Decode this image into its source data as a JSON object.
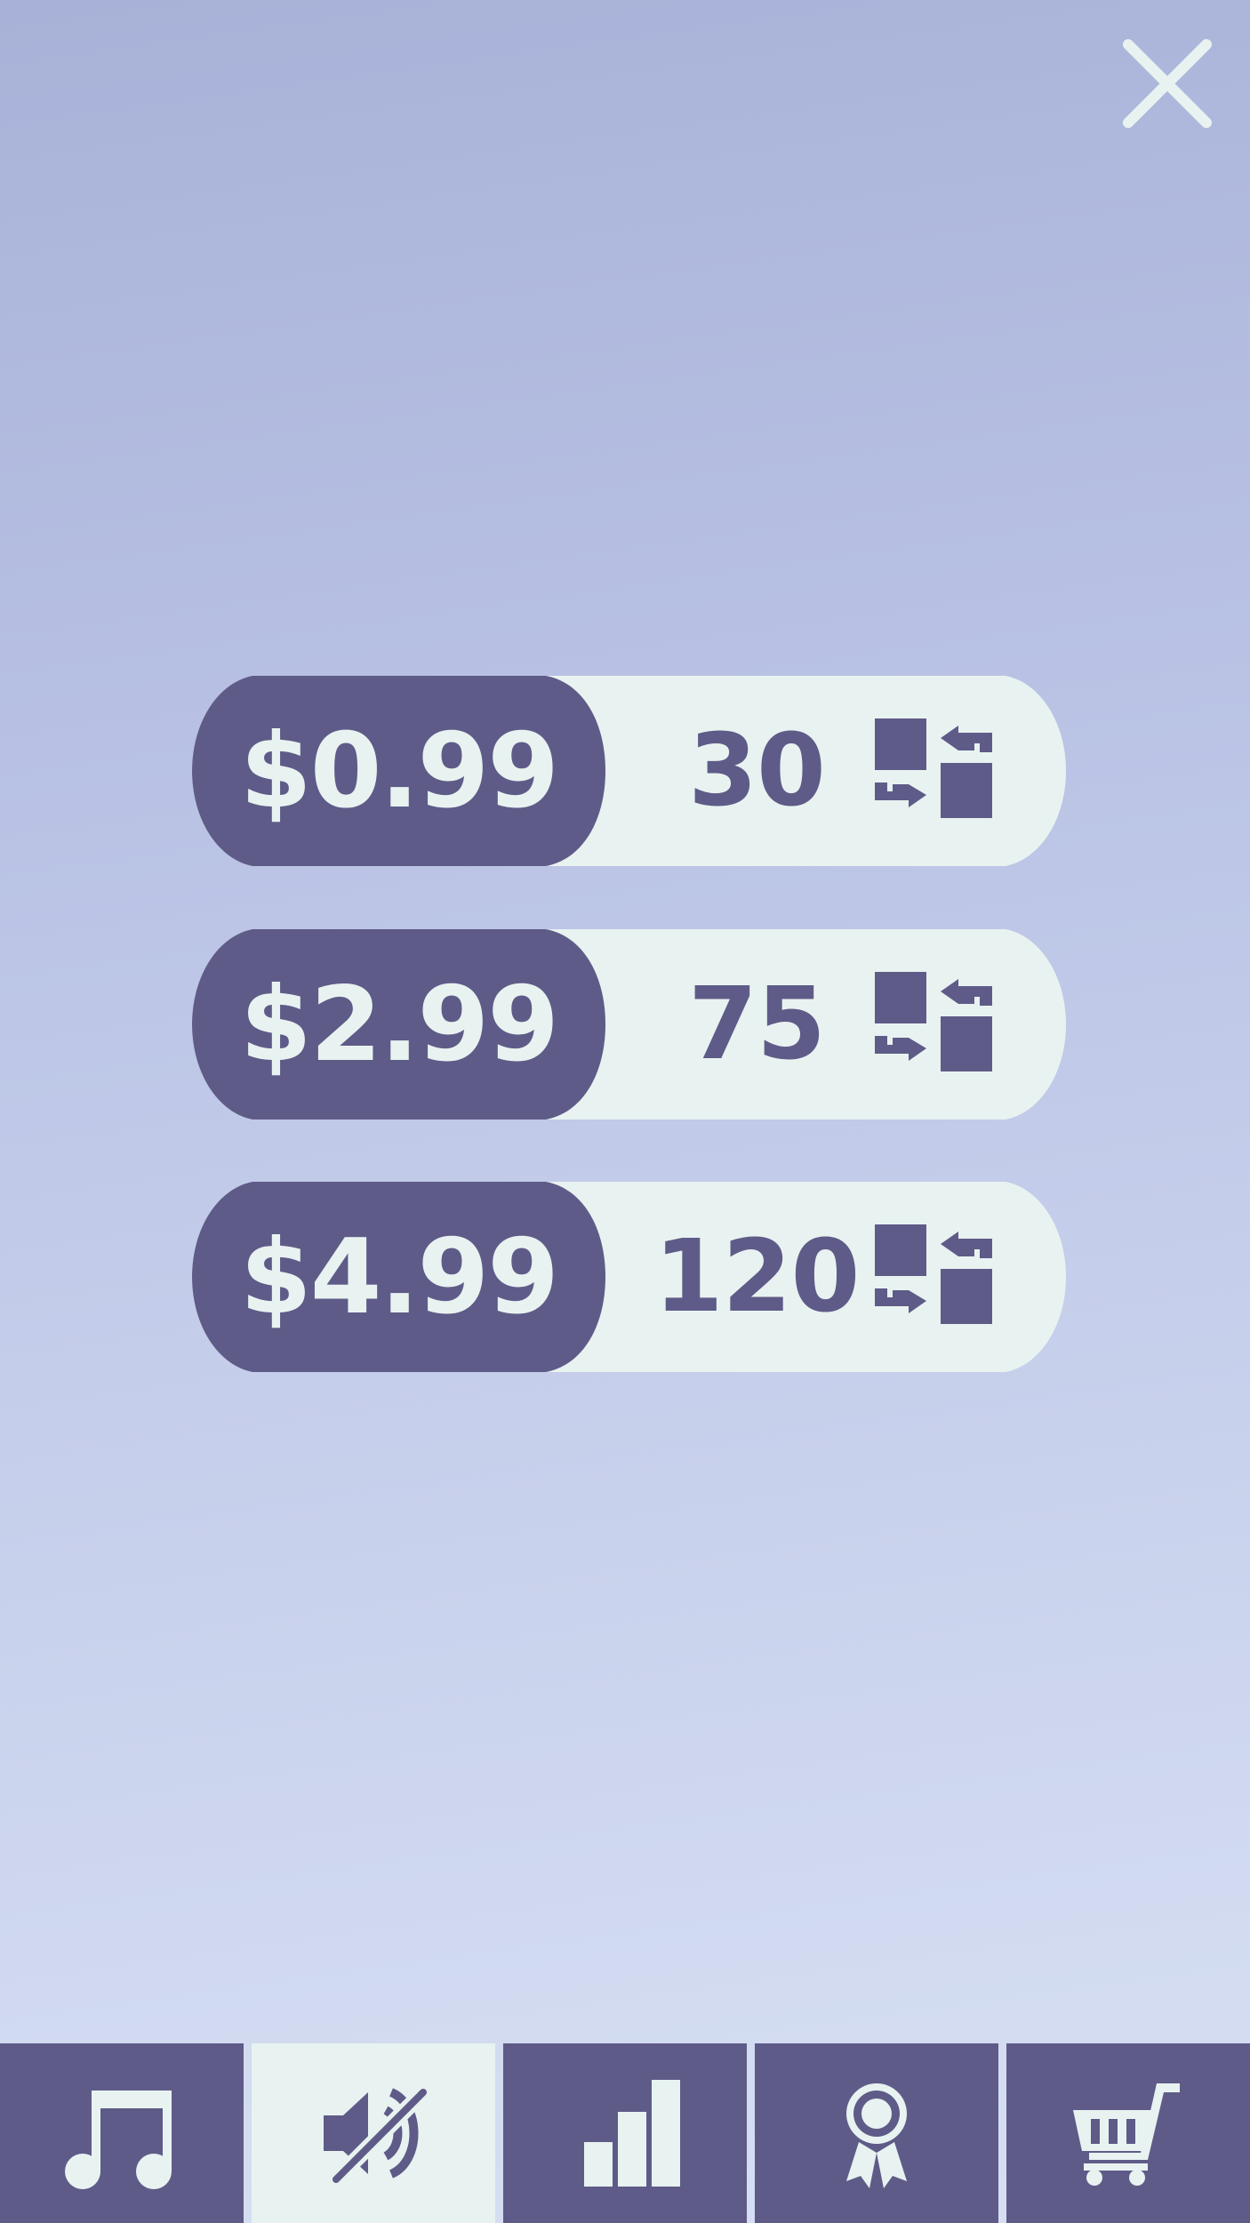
{
  "colors": {
    "accent": "#5f5b88",
    "light": "#e8f3f1",
    "background_top": "#a8b2d8",
    "background_bottom": "#d6def2"
  },
  "header": {
    "close_icon": "close-icon"
  },
  "packs": [
    {
      "price": "$0.99",
      "amount": "30",
      "icon": "exchange-icon"
    },
    {
      "price": "$2.99",
      "amount": "75",
      "icon": "exchange-icon"
    },
    {
      "price": "$4.99",
      "amount": "120",
      "icon": "exchange-icon"
    }
  ],
  "nav": {
    "active_tab": "sound",
    "tabs": [
      {
        "id": "music",
        "icon": "music-note-icon"
      },
      {
        "id": "sound",
        "icon": "sound-muted-icon"
      },
      {
        "id": "stats",
        "icon": "bar-chart-icon"
      },
      {
        "id": "achievements",
        "icon": "award-ribbon-icon"
      },
      {
        "id": "shop",
        "icon": "shopping-cart-icon"
      }
    ]
  }
}
